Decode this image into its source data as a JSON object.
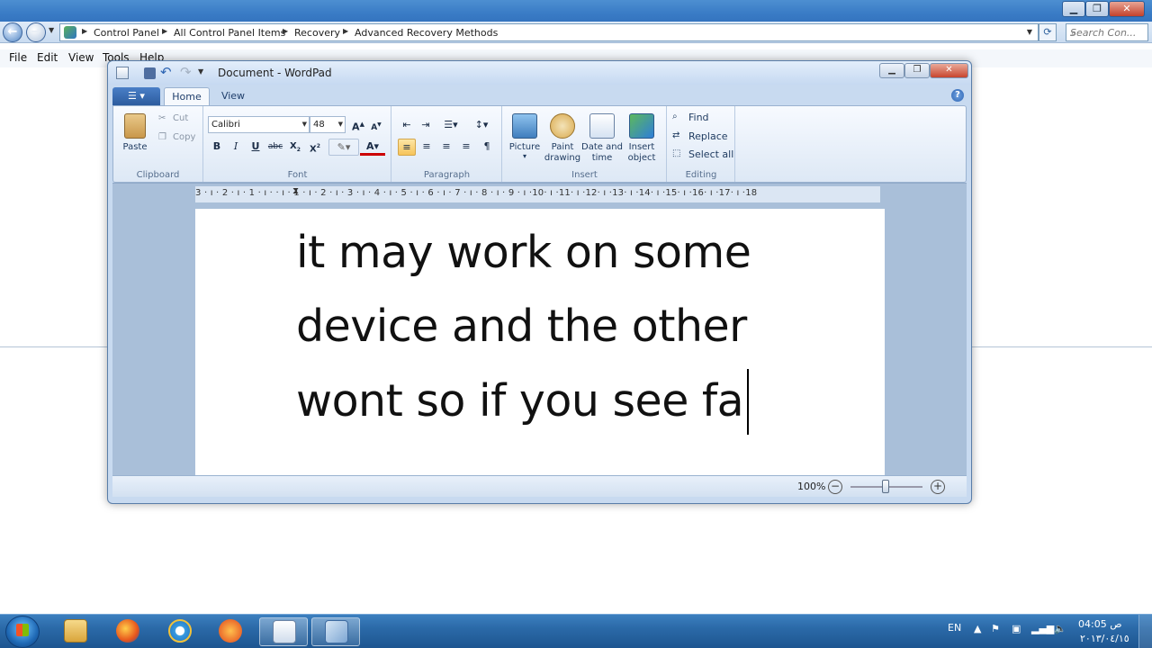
{
  "explorer": {
    "breadcrumbs": [
      "Control Panel",
      "All Control Panel Items",
      "Recovery",
      "Advanced Recovery Methods"
    ],
    "search_placeholder": "Search Con...",
    "menu": [
      "File",
      "Edit",
      "View",
      "Tools",
      "Help"
    ]
  },
  "wordpad": {
    "title": "Document - WordPad",
    "tabs": {
      "home": "Home",
      "view": "View"
    },
    "clipboard": {
      "paste": "Paste",
      "cut": "Cut",
      "copy": "Copy",
      "group": "Clipboard"
    },
    "font": {
      "family": "Calibri",
      "size": "48",
      "group": "Font"
    },
    "paragraph": {
      "group": "Paragraph"
    },
    "insert": {
      "picture": "Picture",
      "paint_line1": "Paint",
      "paint_line2": "drawing",
      "datetime_line1": "Date and",
      "datetime_line2": "time",
      "object_line1": "Insert",
      "object_line2": "object",
      "group": "Insert"
    },
    "editing": {
      "find": "Find",
      "replace": "Replace",
      "select_all": "Select all",
      "group": "Editing"
    },
    "ruler": "3 · ı · 2 · ı · 1 · ı ·   · ı · 1 · ı · 2 · ı · 3 · ı · 4 · ı · 5 · ı · 6 · ı · 7 · ı · 8 · ı · 9 · ı ·10· ı ·11· ı ·12· ı ·13· ı ·14· ı ·15· ı ·16· ı ·17· ı ·18",
    "document_lines": [
      "it may work on some",
      "device and the other",
      "wont so if you see fa"
    ],
    "zoom": "100%"
  },
  "taskbar": {
    "language": "EN",
    "time": "04:05 ص",
    "date": "٢٠١٣/٠٤/١٥"
  }
}
